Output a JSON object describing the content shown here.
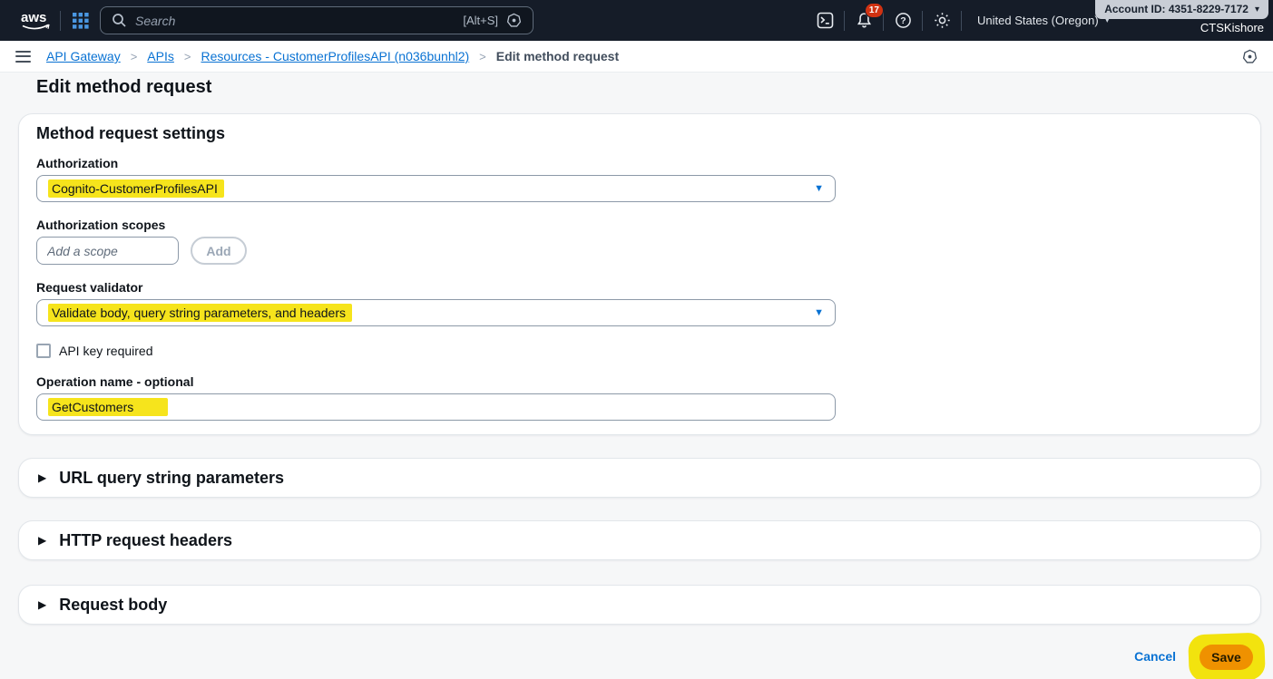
{
  "topbar": {
    "logo": "aws",
    "search": {
      "placeholder": "Search",
      "shortcut": "[Alt+S]"
    },
    "notifications_badge": "17",
    "region": {
      "label": "United States (Oregon)"
    },
    "account_flag": "Account ID: 4351-8229-7172",
    "username": "CTSKishore"
  },
  "breadcrumbs": {
    "items": [
      {
        "label": "API Gateway"
      },
      {
        "label": "APIs"
      },
      {
        "label": "Resources - CustomerProfilesAPI (n036bunhl2)"
      },
      {
        "label": "Edit method request"
      }
    ]
  },
  "page": {
    "title": "Edit method request"
  },
  "settings_card": {
    "title": "Method request settings",
    "authorization": {
      "label": "Authorization",
      "value": "Cognito-CustomerProfilesAPI"
    },
    "scopes": {
      "label": "Authorization scopes",
      "placeholder": "Add a scope",
      "add_button": "Add"
    },
    "validator": {
      "label": "Request validator",
      "value": "Validate body, query string parameters, and headers"
    },
    "api_key": {
      "label": "API key required",
      "checked": false
    },
    "operation": {
      "label": "Operation name - optional",
      "value": "GetCustomers"
    }
  },
  "sections": [
    {
      "label": "URL query string parameters"
    },
    {
      "label": "HTTP request headers"
    },
    {
      "label": "Request body"
    }
  ],
  "footer": {
    "cancel": "Cancel",
    "save": "Save"
  },
  "icons": {
    "caret_down": "▼",
    "caret_small": "▾",
    "expander": "▶",
    "crumb_sep": ">",
    "help": "?"
  },
  "colors": {
    "link": "#0972d3",
    "marker_highlight": "#f6e41c",
    "save_button": "#ef9100",
    "badge": "#d13212",
    "topbar_bg": "#151c28"
  }
}
